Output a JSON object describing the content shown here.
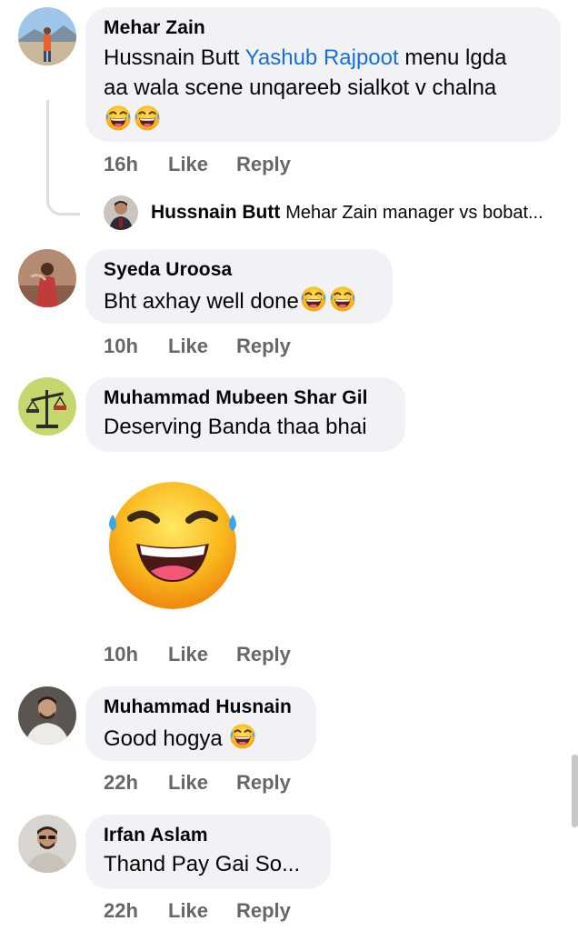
{
  "colors": {
    "bubble": "#f0f2f5",
    "meta": "#65676b",
    "link": "#1a6fd6",
    "text": "#050505"
  },
  "comments": [
    {
      "author": "Mehar Zain",
      "mention_prefix": "Hussnain Butt ",
      "mention": "Yashub Rajpoot",
      "text_line1_rest": " menu lgda",
      "text_line2": "aa wala scene unqareeb sialkot v chalna",
      "emojis": [
        "laughing-tears",
        "laughing-tears"
      ],
      "time": "16h",
      "like": "Like",
      "reply": "Reply",
      "reply_preview": {
        "author": "Hussnain Butt",
        "text": "Mehar Zain manager vs bobat..."
      }
    },
    {
      "author": "Syeda Uroosa",
      "text": "Bht axhay well done",
      "emojis": [
        "laughing-tears",
        "laughing-tears"
      ],
      "time": "10h",
      "like": "Like",
      "reply": "Reply"
    },
    {
      "author": "Muhammad Mubeen Shar Gil",
      "text": "Deserving Banda thaa bhai",
      "sticker": "big-laughing-emoji",
      "time": "10h",
      "like": "Like",
      "reply": "Reply"
    },
    {
      "author": "Muhammad Husnain",
      "text": "Good hogya ",
      "emojis": [
        "laughing-tears"
      ],
      "time": "22h",
      "like": "Like",
      "reply": "Reply"
    },
    {
      "author": "Irfan Aslam",
      "text": "Thand Pay Gai So...",
      "time": "22h",
      "like": "Like",
      "reply": "Reply"
    }
  ]
}
